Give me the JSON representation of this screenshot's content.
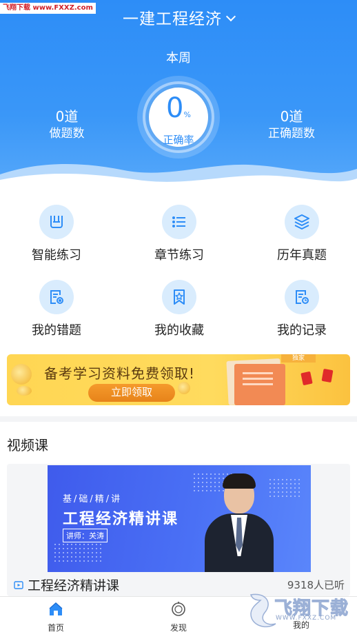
{
  "watermark_top": "飞翔下载 www.FXXZ.com",
  "header": {
    "title": "一建工程经济",
    "period": "本周",
    "done_count": "0道",
    "done_label": "做题数",
    "accuracy_value": "0",
    "accuracy_unit": "%",
    "accuracy_label": "正确率",
    "correct_count": "0道",
    "correct_label": "正确题数"
  },
  "grid": {
    "items": [
      {
        "label": "智能练习",
        "icon": "smart-practice-icon"
      },
      {
        "label": "章节练习",
        "icon": "list-icon"
      },
      {
        "label": "历年真题",
        "icon": "layers-icon"
      },
      {
        "label": "我的错题",
        "icon": "wrong-doc-icon"
      },
      {
        "label": "我的收藏",
        "icon": "bookmark-star-icon"
      },
      {
        "label": "我的记录",
        "icon": "record-clock-icon"
      }
    ]
  },
  "banner": {
    "text": "备考学习资料免费领取!",
    "button": "立即领取",
    "tag": "独家"
  },
  "video_section": {
    "title": "视频课",
    "thumb_subtitle": "基/础/精/讲",
    "thumb_title": "工程经济精讲课",
    "thumb_lecturer": "讲师：关涛",
    "course_name": "工程经济精讲课",
    "listeners": "9318人已听"
  },
  "nav": {
    "home": "首页",
    "discover": "发现",
    "me": "我的"
  },
  "watermark_bottom": {
    "brand": "飞翔下载",
    "url": "WWW.FXXZ.COM"
  },
  "colors": {
    "primary": "#2d8df7",
    "icon_bg": "#d9ecfd",
    "banner": "#ffd653",
    "button": "#e7831a"
  }
}
